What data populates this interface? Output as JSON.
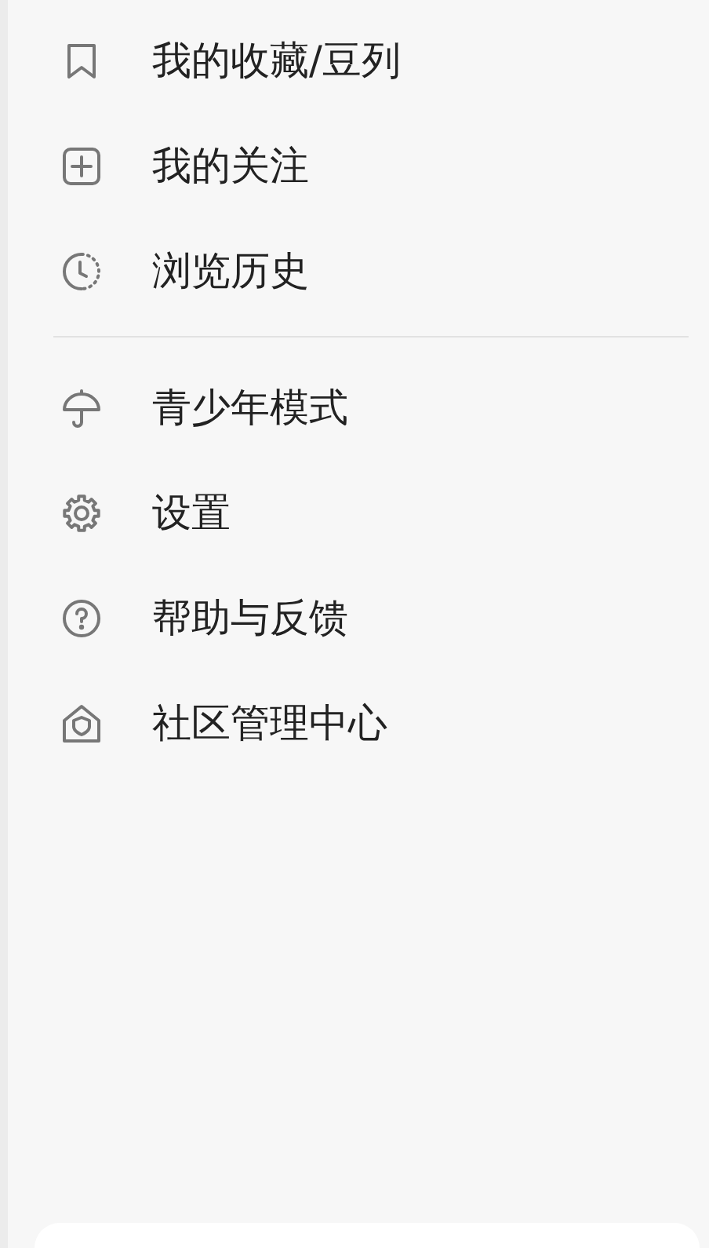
{
  "menu_groups": [
    {
      "items": [
        {
          "kind": "bookmark",
          "label": "我的收藏/豆列"
        },
        {
          "kind": "plus",
          "label": "我的关注"
        },
        {
          "kind": "clock",
          "label": "浏览历史"
        }
      ]
    },
    {
      "items": [
        {
          "kind": "umbrella",
          "label": "青少年模式"
        },
        {
          "kind": "gear",
          "label": "设置"
        },
        {
          "kind": "help",
          "label": "帮助与反馈"
        },
        {
          "kind": "shield-house",
          "label": "社区管理中心"
        }
      ]
    }
  ]
}
